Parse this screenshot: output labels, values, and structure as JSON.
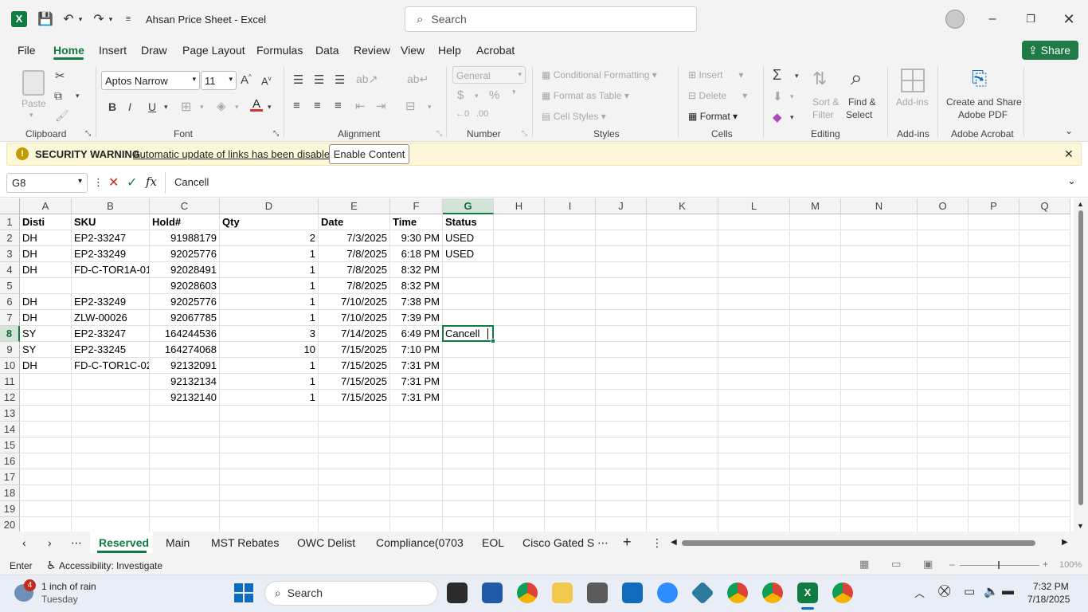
{
  "title": {
    "app_name": "Ahsan Price Sheet  -  Excel",
    "search_placeholder": "Search"
  },
  "menu": [
    "File",
    "Home",
    "Insert",
    "Draw",
    "Page Layout",
    "Formulas",
    "Data",
    "Review",
    "View",
    "Help",
    "Acrobat"
  ],
  "share_label": "Share",
  "ribbon": {
    "paste": "Paste",
    "font_name": "Aptos Narrow",
    "font_size": "11",
    "number_format": "General",
    "conditional_formatting": "Conditional Formatting",
    "format_as_table": "Format as Table",
    "cell_styles": "Cell Styles",
    "insert": "Insert",
    "delete": "Delete",
    "format": "Format",
    "sort_filter_1": "Sort &",
    "sort_filter_2": "Filter",
    "find_select_1": "Find &",
    "find_select_2": "Select",
    "addins": "Add-ins",
    "create_pdf_1": "Create and Share",
    "create_pdf_2": "Adobe PDF",
    "groups": {
      "clipboard": "Clipboard",
      "font": "Font",
      "alignment": "Alignment",
      "number": "Number",
      "styles": "Styles",
      "cells": "Cells",
      "editing": "Editing",
      "addins": "Add-ins",
      "acrobat": "Adobe Acrobat"
    }
  },
  "warning": {
    "title": "SECURITY WARNING",
    "message": "Automatic update of links has been disabled",
    "button": "Enable Content"
  },
  "formula": {
    "name_box": "G8",
    "content": "Cancell"
  },
  "columns": [
    "A",
    "B",
    "C",
    "D",
    "E",
    "F",
    "G",
    "H",
    "I",
    "J",
    "K",
    "L",
    "M",
    "N",
    "O",
    "P",
    "Q"
  ],
  "rows": [
    [
      "Disti",
      "SKU",
      "Hold#",
      "Qty",
      "Date",
      "Time",
      "Status"
    ],
    [
      "DH",
      "EP2-33247",
      "91988179",
      "2",
      "7/3/2025",
      "9:30 PM",
      "USED"
    ],
    [
      "DH",
      "EP2-33249",
      "92025776",
      "1",
      "7/8/2025",
      "6:18 PM",
      "USED"
    ],
    [
      "DH",
      "FD-C-TOR1A-01",
      "92028491",
      "1",
      "7/8/2025",
      "8:32 PM",
      ""
    ],
    [
      "",
      "",
      "92028603",
      "1",
      "7/8/2025",
      "8:32 PM",
      ""
    ],
    [
      "DH",
      "EP2-33249",
      "92025776",
      "1",
      "7/10/2025",
      "7:38 PM",
      ""
    ],
    [
      "DH",
      "ZLW-00026",
      "92067785",
      "1",
      "7/10/2025",
      "7:39 PM",
      ""
    ],
    [
      "SY",
      "EP2-33247",
      "164244536",
      "3",
      "7/14/2025",
      "6:49 PM",
      "Cancell"
    ],
    [
      "SY",
      "EP2-33245",
      "164274068",
      "10",
      "7/15/2025",
      "7:10 PM",
      ""
    ],
    [
      "DH",
      "FD-C-TOR1C-02",
      "92132091",
      "1",
      "7/15/2025",
      "7:31 PM",
      ""
    ],
    [
      "",
      "",
      "92132134",
      "1",
      "7/15/2025",
      "7:31 PM",
      ""
    ],
    [
      "",
      "",
      "92132140",
      "1",
      "7/15/2025",
      "7:31 PM",
      ""
    ]
  ],
  "row_numbers": [
    "1",
    "2",
    "3",
    "4",
    "5",
    "6",
    "7",
    "8",
    "9",
    "10",
    "11",
    "12",
    "13",
    "14",
    "15",
    "16",
    "17",
    "18",
    "19",
    "20"
  ],
  "sheets": [
    "Reserved",
    "Main",
    "MST Rebates",
    "OWC Delist",
    "Compliance(0703",
    "EOL",
    "Cisco Gated S"
  ],
  "status": {
    "mode": "Enter",
    "accessibility": "Accessibility: Investigate",
    "zoom": "100%"
  },
  "taskbar": {
    "weather_badge": "4",
    "weather_text": "1 inch of rain",
    "weather_day": "Tuesday",
    "search": "Search",
    "time": "7:32 PM",
    "date": "7/18/2025"
  },
  "colors": {
    "excel_green": "#107c41",
    "accent_green": "#1f7a45",
    "warning_bg": "#fcf7d9"
  }
}
